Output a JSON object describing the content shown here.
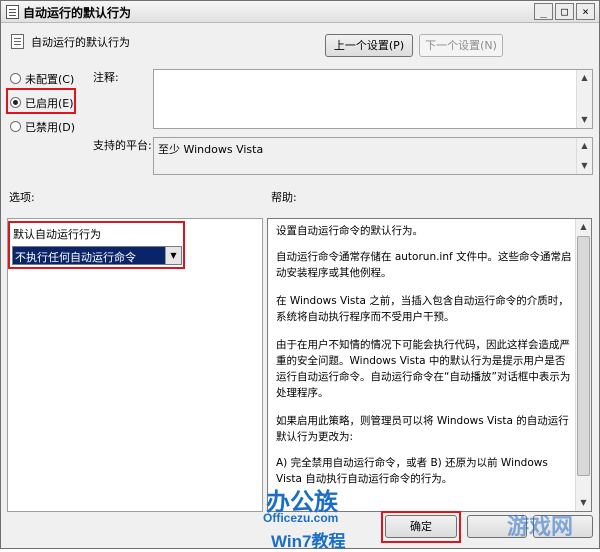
{
  "window": {
    "title": "自动运行的默认行为"
  },
  "header": {
    "policy_name": "自动运行的默认行为",
    "prev_button": "上一个设置(P)",
    "next_button": "下一个设置(N)"
  },
  "state": {
    "options": [
      {
        "label": "未配置(C)",
        "selected": false
      },
      {
        "label": "已启用(E)",
        "selected": true
      },
      {
        "label": "已禁用(D)",
        "selected": false
      }
    ]
  },
  "comment": {
    "label": "注释:",
    "value": ""
  },
  "supported": {
    "label": "支持的平台:",
    "value": "至少 Windows Vista"
  },
  "options_panel": {
    "label": "选项:",
    "setting_label": "默认自动运行行为",
    "dropdown_value": "不执行任何自动运行命令"
  },
  "help_panel": {
    "label": "帮助:",
    "paragraphs": [
      "设置自动运行命令的默认行为。",
      "自动运行命令通常存储在 autorun.inf 文件中。这些命令通常启动安装程序或其他例程。",
      "在 Windows Vista 之前，当插入包含自动运行命令的介质时，系统将自动执行程序而不受用户干预。",
      "由于在用户不知情的情况下可能会执行代码，因此这样会造成严重的安全问题。Windows Vista 中的默认行为是提示用户是否运行自动运行命令。自动运行命令在“自动播放”对话框中表示为处理程序。",
      "如果启用此策略，则管理员可以将 Windows Vista 的自动运行默认行为更改为:",
      "A) 完全禁用自动运行命令，或者 B) 还原为以前 Windows Vista 自动执行自动运行命令的行为。"
    ]
  },
  "footer": {
    "ok_button": "确定"
  },
  "watermarks": {
    "left_brand": "办公族",
    "left_url": "Officezu.com",
    "left_sub": "Win7教程",
    "right_brand": "游戏网"
  },
  "colors": {
    "highlight_red": "#e0141e",
    "selection_blue": "#0a246a"
  }
}
